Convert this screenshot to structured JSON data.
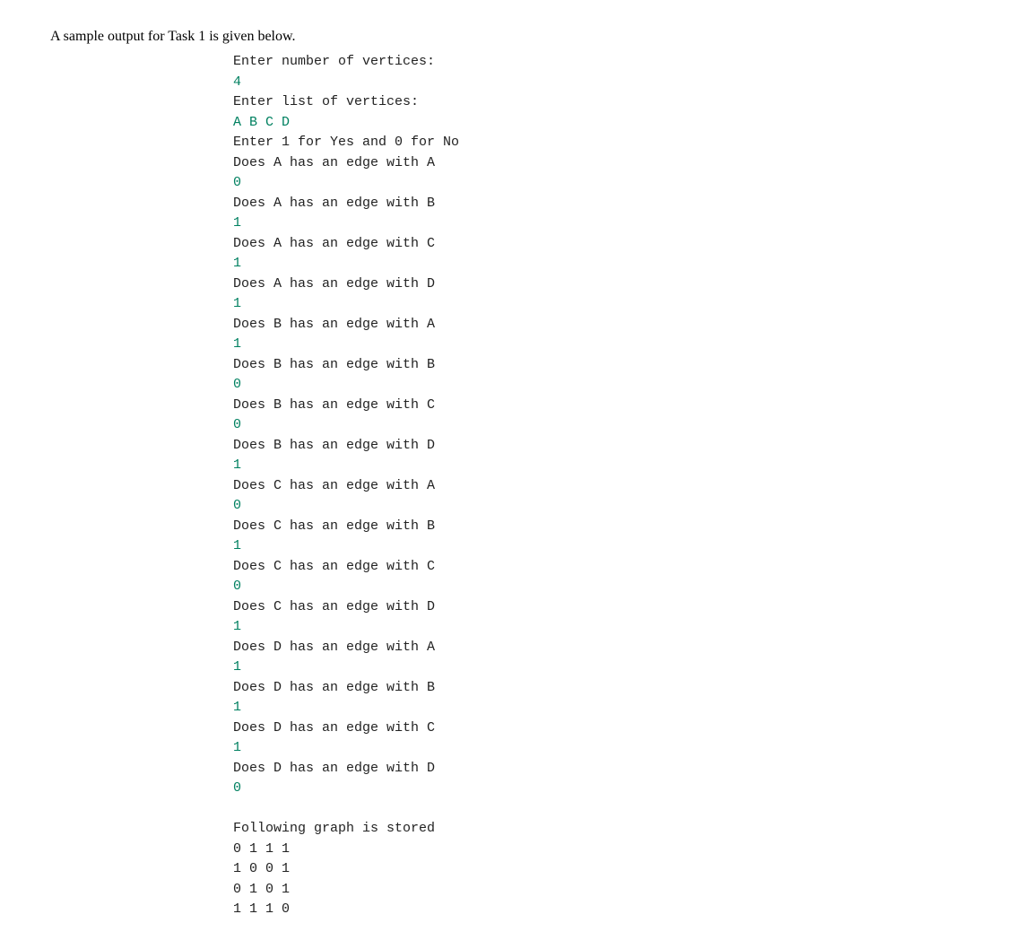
{
  "intro": "A sample output for Task 1 is given below.",
  "lines": [
    {
      "cls": "prompt",
      "text": "Enter number of vertices:"
    },
    {
      "cls": "input",
      "text": "4"
    },
    {
      "cls": "prompt",
      "text": "Enter list of vertices:"
    },
    {
      "cls": "input",
      "text": "A B C D"
    },
    {
      "cls": "prompt",
      "text": "Enter 1 for Yes and 0 for No"
    },
    {
      "cls": "prompt",
      "text": "Does A has an edge with A"
    },
    {
      "cls": "input",
      "text": "0"
    },
    {
      "cls": "prompt",
      "text": "Does A has an edge with B"
    },
    {
      "cls": "input",
      "text": "1"
    },
    {
      "cls": "prompt",
      "text": "Does A has an edge with C"
    },
    {
      "cls": "input",
      "text": "1"
    },
    {
      "cls": "prompt",
      "text": "Does A has an edge with D"
    },
    {
      "cls": "input",
      "text": "1"
    },
    {
      "cls": "prompt",
      "text": "Does B has an edge with A"
    },
    {
      "cls": "input",
      "text": "1"
    },
    {
      "cls": "prompt",
      "text": "Does B has an edge with B"
    },
    {
      "cls": "input",
      "text": "0"
    },
    {
      "cls": "prompt",
      "text": "Does B has an edge with C"
    },
    {
      "cls": "input",
      "text": "0"
    },
    {
      "cls": "prompt",
      "text": "Does B has an edge with D"
    },
    {
      "cls": "input",
      "text": "1"
    },
    {
      "cls": "prompt",
      "text": "Does C has an edge with A"
    },
    {
      "cls": "input",
      "text": "0"
    },
    {
      "cls": "prompt",
      "text": "Does C has an edge with B"
    },
    {
      "cls": "input",
      "text": "1"
    },
    {
      "cls": "prompt",
      "text": "Does C has an edge with C"
    },
    {
      "cls": "input",
      "text": "0"
    },
    {
      "cls": "prompt",
      "text": "Does C has an edge with D"
    },
    {
      "cls": "input",
      "text": "1"
    },
    {
      "cls": "prompt",
      "text": "Does D has an edge with A"
    },
    {
      "cls": "input",
      "text": "1"
    },
    {
      "cls": "prompt",
      "text": "Does D has an edge with B"
    },
    {
      "cls": "input",
      "text": "1"
    },
    {
      "cls": "prompt",
      "text": "Does D has an edge with C"
    },
    {
      "cls": "input",
      "text": "1"
    },
    {
      "cls": "prompt",
      "text": "Does D has an edge with D"
    },
    {
      "cls": "input",
      "text": "0"
    },
    {
      "cls": "prompt",
      "text": ""
    },
    {
      "cls": "prompt",
      "text": "Following graph is stored"
    },
    {
      "cls": "prompt",
      "text": "0 1 1 1"
    },
    {
      "cls": "prompt",
      "text": "1 0 0 1"
    },
    {
      "cls": "prompt",
      "text": "0 1 0 1"
    },
    {
      "cls": "prompt",
      "text": "1 1 1 0"
    }
  ]
}
